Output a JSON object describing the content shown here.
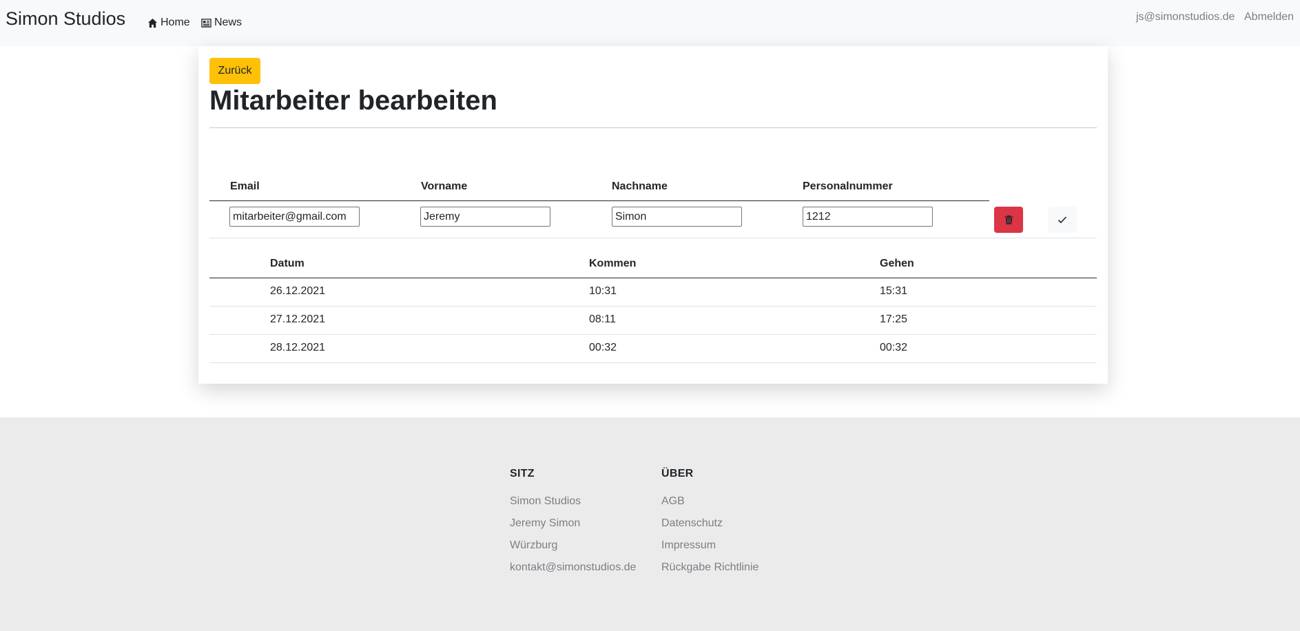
{
  "navbar": {
    "brand": "Simon Studios",
    "links": [
      {
        "label": "Home",
        "icon": "home-icon"
      },
      {
        "label": "News",
        "icon": "newspaper-icon"
      }
    ],
    "user_email": "js@simonstudios.de",
    "logout_label": "Abmelden"
  },
  "page": {
    "back_label": "Zurück",
    "title": "Mitarbeiter bearbeiten"
  },
  "employee_table": {
    "headers": [
      "Email",
      "Vorname",
      "Nachname",
      "Personalnummer"
    ],
    "values": {
      "email": "mitarbeiter@gmail.com",
      "vorname": "Jeremy",
      "nachname": "Simon",
      "personalnummer": "1212"
    },
    "delete_icon": "trash-icon",
    "save_icon": "check-icon"
  },
  "time_table": {
    "headers": [
      "Datum",
      "Kommen",
      "Gehen"
    ],
    "rows": [
      {
        "datum": "26.12.2021",
        "kommen": "10:31",
        "gehen": "15:31"
      },
      {
        "datum": "27.12.2021",
        "kommen": "08:11",
        "gehen": "17:25"
      },
      {
        "datum": "28.12.2021",
        "kommen": "00:32",
        "gehen": "00:32"
      }
    ]
  },
  "footer": {
    "columns": [
      {
        "heading": "SITZ",
        "items": [
          "Simon Studios",
          "Jeremy Simon",
          "Würzburg",
          "kontakt@simonstudios.de"
        ]
      },
      {
        "heading": "ÜBER",
        "items": [
          "AGB",
          "Datenschutz",
          "Impressum",
          "Rückgabe Richtlinie"
        ]
      }
    ]
  },
  "colors": {
    "warning": "#ffc107",
    "danger": "#dc3545",
    "navbar_bg": "#f8f9fa",
    "footer_bg": "#ebebeb"
  }
}
